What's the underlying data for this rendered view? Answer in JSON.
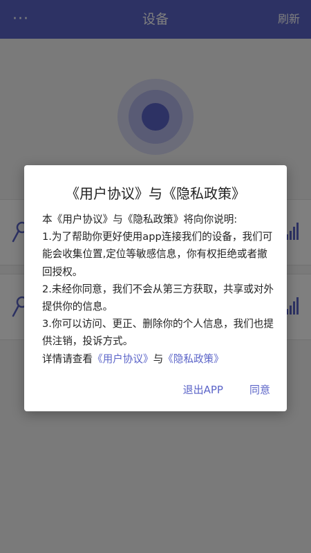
{
  "app_bar": {
    "title": "设备",
    "refresh_label": "刷新",
    "menu_glyph": "···",
    "color": "#5b64c8"
  },
  "dialog": {
    "title": "《用户协议》与《隐私政策》",
    "lines": [
      "本《用户协议》与《隐私政策》将向你说明:",
      "1.为了帮助你更好使用app连接我们的设备，我们可能会收集位置,定位等敏感信息，你有权拒绝或者撤回授权。",
      "2.未经你同意，我们不会从第三方获取，共享或对外提供你的信息。",
      "3.你可以访问、更正、删除你的个人信息，我们也提供注销，投诉方式。"
    ],
    "detail_prefix": "详情请查看",
    "link_user_agreement": "《用户协议》",
    "detail_and": "与",
    "link_privacy_policy": "《隐私政策》",
    "exit_button": "退出APP",
    "agree_button": "同意"
  }
}
